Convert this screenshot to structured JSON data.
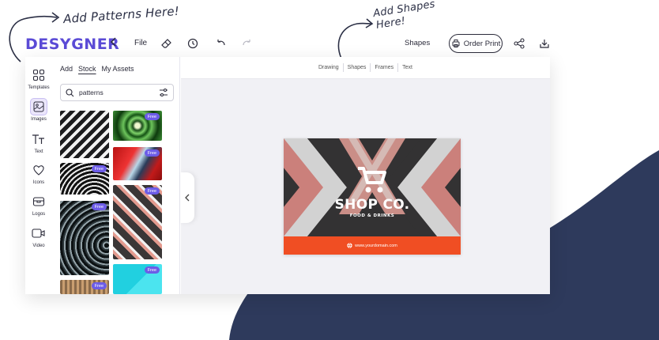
{
  "annotations": {
    "patterns": "Add Patterns Here!",
    "shapes_line1": "Add Shapes",
    "shapes_line2": "Here!"
  },
  "header": {
    "logo": "DESYGNER",
    "file_label": "File",
    "shapes_label": "Shapes",
    "order_print_label": "Order Print"
  },
  "sidebar": {
    "items": [
      {
        "label": "Templates",
        "icon": "grid-icon"
      },
      {
        "label": "Images",
        "icon": "image-icon",
        "active": true
      },
      {
        "label": "Text",
        "icon": "text-icon"
      },
      {
        "label": "Icons",
        "icon": "heart-icon"
      },
      {
        "label": "Logos",
        "icon": "logo-icon"
      },
      {
        "label": "Video",
        "icon": "video-icon"
      }
    ]
  },
  "panel": {
    "tabs": [
      "Add",
      "Stock",
      "My Assets"
    ],
    "active_tab": "Stock",
    "search_value": "patterns",
    "badge_label": "Free"
  },
  "canvas": {
    "tabs": [
      "Drawing",
      "Shapes",
      "Frames",
      "Text"
    ]
  },
  "design": {
    "title": "SHOP CO.",
    "subtitle": "FOOD & DRINKS",
    "website": "www.yourdomain.com"
  },
  "colors": {
    "brand": "#5b4bd6",
    "badge": "#6c5ce7",
    "blob": "#2e3a5c",
    "band": "#f04e23"
  }
}
